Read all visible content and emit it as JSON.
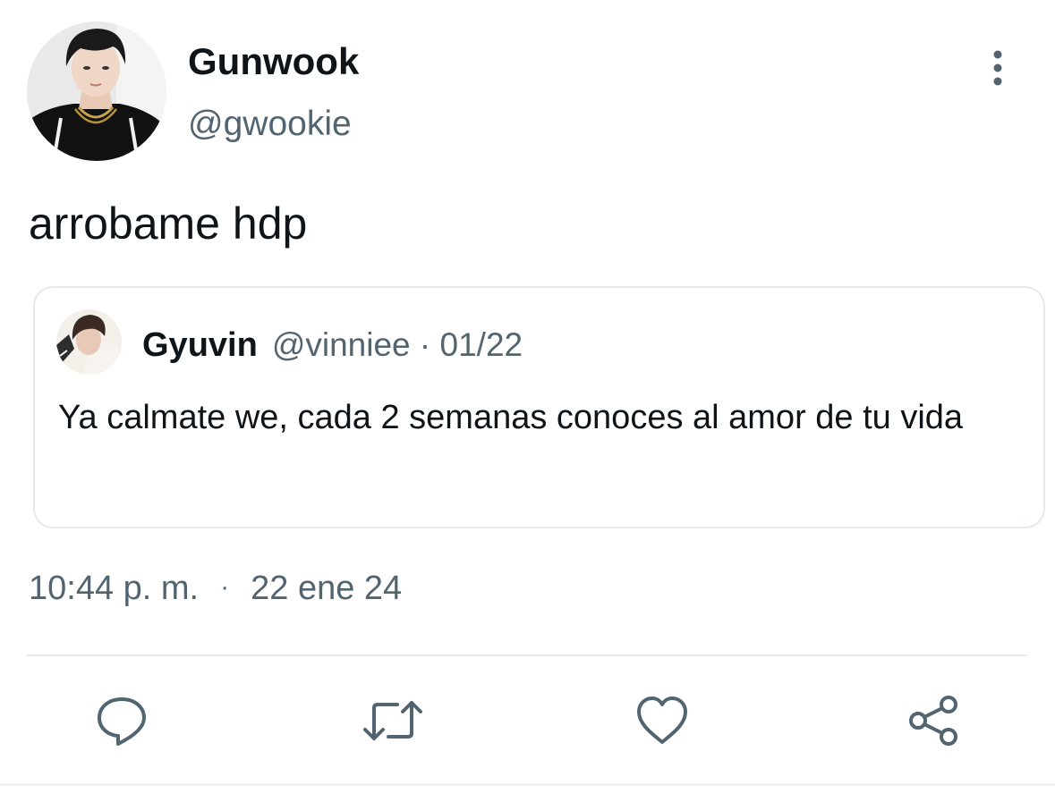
{
  "author": {
    "display_name": "Gunwook",
    "handle": "@gwookie"
  },
  "tweet": {
    "text": "arrobame hdp",
    "time": "10:44 p. m.",
    "separator": "·",
    "date": "22 ene 24"
  },
  "quoted_tweet": {
    "display_name": "Gyuvin",
    "handle_and_date": "@vinniee · 01/22",
    "text": "Ya calmate we, cada 2 semanas conoces al amor de tu vida"
  },
  "actions": {
    "reply_icon": "reply-icon",
    "retweet_icon": "retweet-icon",
    "like_icon": "heart-icon",
    "share_icon": "share-icon",
    "more_icon": "more-vertical-icon"
  },
  "colors": {
    "text_primary": "#0f1419",
    "text_secondary": "#536471",
    "border": "#e5e9ec",
    "icon": "#536471"
  }
}
